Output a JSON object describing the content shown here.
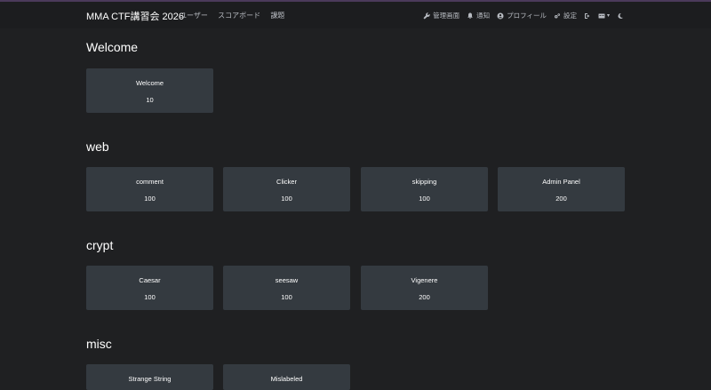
{
  "navbar": {
    "brand": "MMA CTF講習会 2026",
    "links": [
      "ユーザー",
      "スコアボード",
      "課題"
    ],
    "admin": "管理画面",
    "notifications": "通知",
    "profile": "プロフィール",
    "settings": "設定"
  },
  "sections": [
    {
      "title": "Welcome",
      "challenges": [
        {
          "name": "Welcome",
          "value": "10"
        }
      ]
    },
    {
      "title": "web",
      "challenges": [
        {
          "name": "comment",
          "value": "100"
        },
        {
          "name": "Clicker",
          "value": "100"
        },
        {
          "name": "skipping",
          "value": "100"
        },
        {
          "name": "Admin Panel",
          "value": "200"
        }
      ]
    },
    {
      "title": "crypt",
      "challenges": [
        {
          "name": "Caesar",
          "value": "100"
        },
        {
          "name": "seesaw",
          "value": "100"
        },
        {
          "name": "Vigenere",
          "value": "200"
        }
      ]
    },
    {
      "title": "misc",
      "challenges": [
        {
          "name": "Strange String",
          "value": ""
        },
        {
          "name": "Mislabeled",
          "value": ""
        }
      ]
    }
  ]
}
